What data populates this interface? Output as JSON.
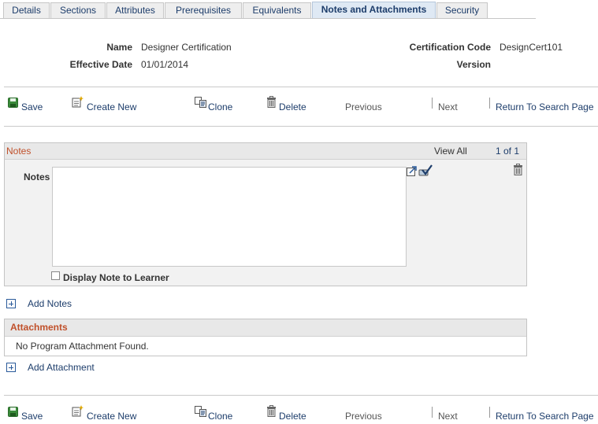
{
  "tabs": [
    {
      "label": "Details"
    },
    {
      "label": "Sections"
    },
    {
      "label": "Attributes"
    },
    {
      "label": "Prerequisites"
    },
    {
      "label": "Equivalents"
    },
    {
      "label": "Notes and Attachments",
      "active": true
    },
    {
      "label": "Security"
    }
  ],
  "header": {
    "name_label": "Name",
    "name_value": "Designer Certification",
    "effective_date_label": "Effective Date",
    "effective_date_value": "01/01/2014",
    "cert_code_label": "Certification Code",
    "cert_code_value": "DesignCert101",
    "version_label": "Version",
    "version_value": ""
  },
  "toolbar": {
    "save": "Save",
    "create_new": "Create New",
    "clone": "Clone",
    "delete": "Delete",
    "previous": "Previous",
    "next": "Next",
    "return": "Return To Search Page"
  },
  "notes_grid": {
    "title": "Notes",
    "view_all": "View All",
    "count": "1 of 1",
    "notes_label": "Notes",
    "notes_value": "",
    "display_note_label": "Display Note to Learner",
    "display_note_checked": false
  },
  "add_notes": "Add Notes",
  "attachments": {
    "title": "Attachments",
    "empty_text": "No Program Attachment Found."
  },
  "add_attachment": "Add Attachment",
  "icons": {
    "save": "save-icon",
    "create_new": "create-new-icon",
    "clone": "clone-icon",
    "delete": "delete-icon",
    "expand": "expand-icon",
    "spell_check": "spell-check-icon",
    "trash": "trash-icon",
    "add": "plus-icon"
  }
}
